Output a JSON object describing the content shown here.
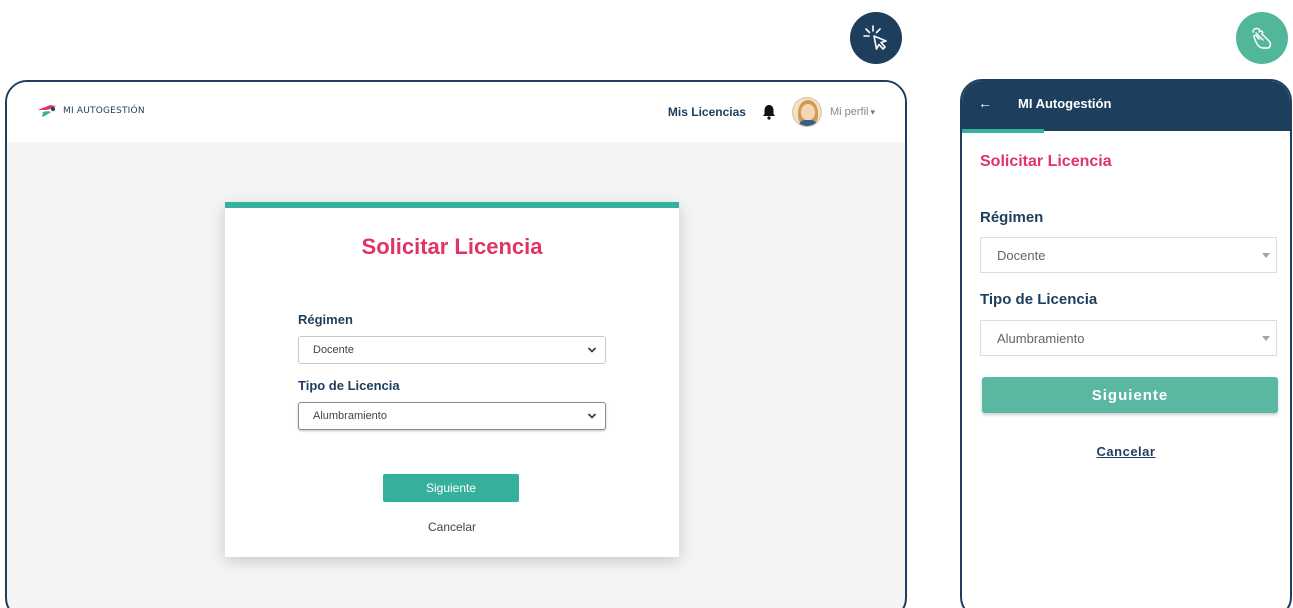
{
  "badges": {
    "desktop_icon": "cursor-click-icon",
    "mobile_icon": "hand-touch-icon"
  },
  "desktop": {
    "brand": "MI AUTOGESTIÓN",
    "nav": {
      "licencias": "Mis Licencias",
      "profile": "Mi perfil"
    },
    "title": "Solicitar Licencia",
    "regimen_label": "Régimen",
    "regimen_value": "Docente",
    "tipo_label": "Tipo de Licencia",
    "tipo_value": "Alumbramiento",
    "next": "Siguiente",
    "cancel": "Cancelar"
  },
  "mobile": {
    "title": "MI Autogestión",
    "back": "←",
    "heading": "Solicitar Licencia",
    "regimen_label": "Régimen",
    "regimen_value": "Docente",
    "tipo_label": "Tipo de Licencia",
    "tipo_value": "Alumbramiento",
    "next": "Siguiente",
    "cancel": "Cancelar"
  },
  "colors": {
    "navy": "#1d3e5d",
    "teal": "#35b09c",
    "pink": "#e03366"
  }
}
